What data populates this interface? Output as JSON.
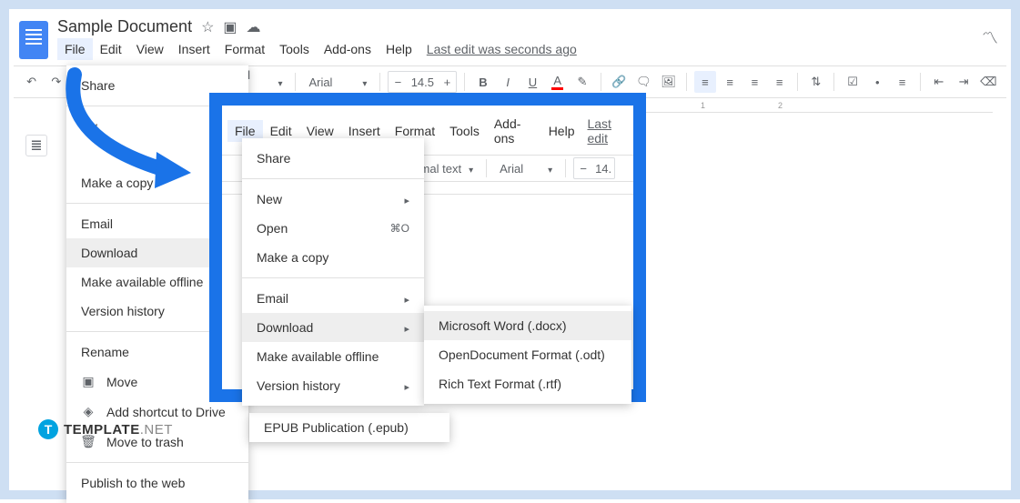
{
  "header": {
    "title": "Sample Document",
    "last_edit": "Last edit was seconds ago"
  },
  "menu": {
    "file": "File",
    "edit": "Edit",
    "view": "View",
    "insert": "Insert",
    "format": "Format",
    "tools": "Tools",
    "addons": "Add-ons",
    "help": "Help"
  },
  "toolbar": {
    "style": "ormal text",
    "font": "Arial",
    "size": "14.5"
  },
  "file_menu": {
    "share": "Share",
    "new": "ew",
    "open_shortcut": "⌘",
    "make_copy": "Make a copy",
    "email": "Email",
    "download": "Download",
    "offline": "Make available offline",
    "version": "Version history",
    "rename": "Rename",
    "move": "Move",
    "add_shortcut": "Add shortcut to Drive",
    "trash": "Move to trash",
    "publish": "Publish to the web"
  },
  "inset": {
    "menu": {
      "file": "File",
      "edit": "Edit",
      "view": "View",
      "insert": "Insert",
      "format": "Format",
      "tools": "Tools",
      "addons": "Add-ons",
      "help": "Help",
      "last_edit": "Last edit"
    },
    "toolbar": {
      "style": "ormal text",
      "font": "Arial",
      "size": "14."
    },
    "file_menu": {
      "share": "Share",
      "new": "New",
      "open": "Open",
      "open_shortcut": "⌘O",
      "make_copy": "Make a copy",
      "email": "Email",
      "download": "Download",
      "offline": "Make available offline",
      "version": "Version history"
    },
    "submenu": {
      "docx": "Microsoft Word (.docx)",
      "odt": "OpenDocument Format (.odt)",
      "rtf": "Rich Text Format (.rtf)"
    }
  },
  "epub": "EPUB Publication (.epub)",
  "ruler": {
    "t1": "1",
    "t2": "2"
  },
  "badge": {
    "t": "T",
    "name": "TEMPLATE",
    "suffix": ".NET"
  }
}
